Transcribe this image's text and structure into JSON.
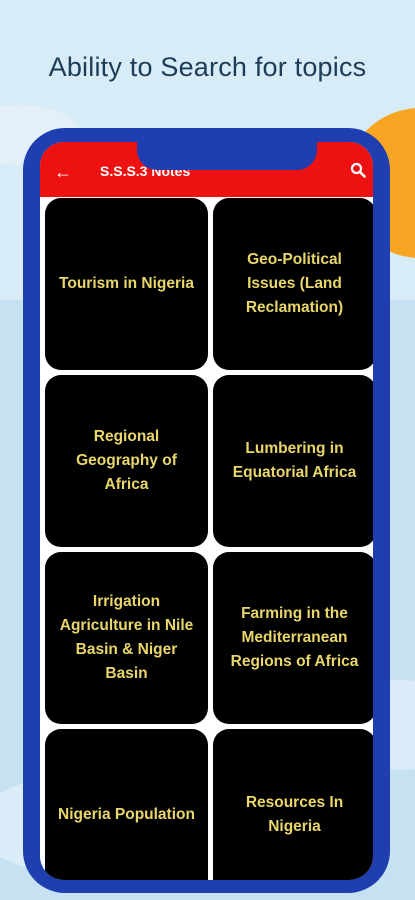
{
  "headline": "Ability to Search for topics",
  "app": {
    "title": "S.S.S.3 Notes",
    "back_icon": "arrow-left-icon",
    "search_icon": "search-icon",
    "bar_color": "#ee1111"
  },
  "colors": {
    "card_background": "#000000",
    "card_text": "#e9d66b",
    "phone_frame": "#1f3fb0",
    "sun": "#f6a623"
  },
  "topics": [
    {
      "label": "Tourism in Nigeria"
    },
    {
      "label": "Geo-Political Issues (Land Reclamation)"
    },
    {
      "label": "Regional Geography of Africa"
    },
    {
      "label": "Lumbering in Equatorial Africa"
    },
    {
      "label": "Irrigation Agriculture in Nile Basin & Niger Basin"
    },
    {
      "label": "Farming in the Mediterranean Regions of Africa"
    },
    {
      "label": "Nigeria Population"
    },
    {
      "label": "Resources In Nigeria"
    }
  ]
}
